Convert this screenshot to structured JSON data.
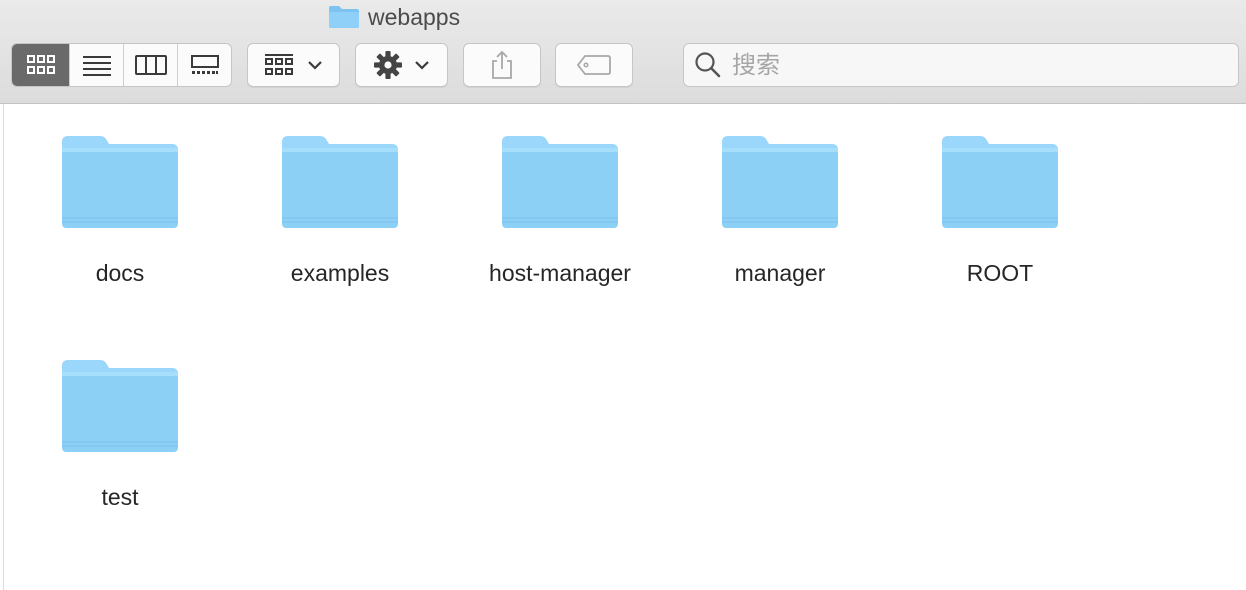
{
  "window": {
    "title": "webapps"
  },
  "toolbar": {
    "view_modes": [
      "icon-view",
      "list-view",
      "column-view",
      "gallery-view"
    ],
    "active_view": "icon-view",
    "search_placeholder": "搜索"
  },
  "folders": [
    {
      "name": "docs"
    },
    {
      "name": "examples"
    },
    {
      "name": "host-manager"
    },
    {
      "name": "manager"
    },
    {
      "name": "ROOT"
    },
    {
      "name": "test"
    }
  ],
  "colors": {
    "folder_top": "#9ad7fa",
    "folder_body": "#8cd0f6",
    "active_segment": "#6a6a6a",
    "toolbar_bg": "#e3e3e3"
  }
}
